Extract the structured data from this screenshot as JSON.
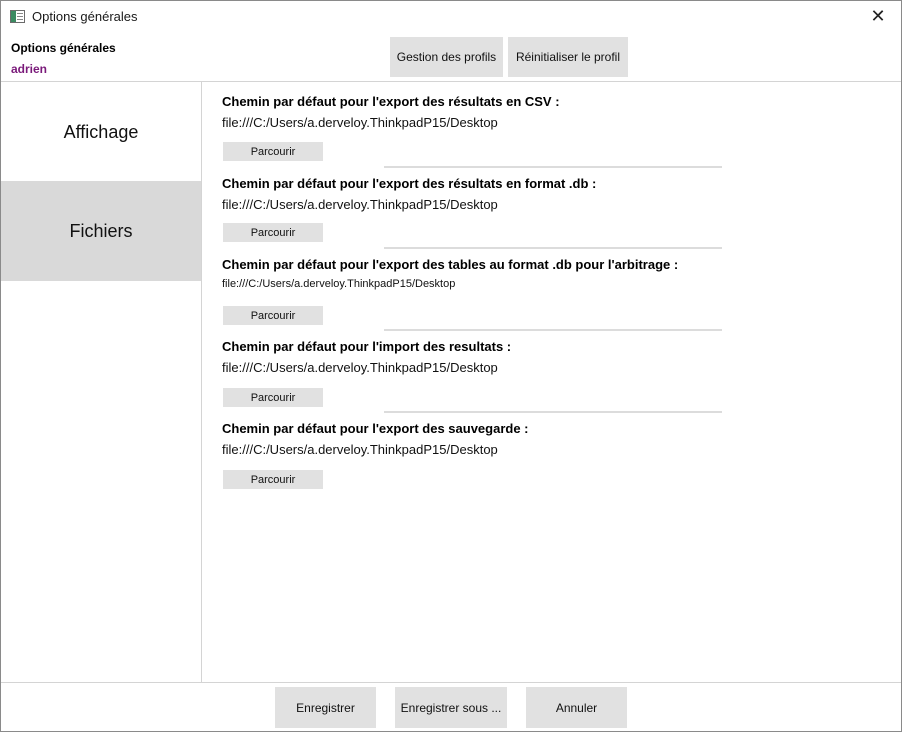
{
  "window": {
    "title": "Options générales",
    "close_icon": "close-icon",
    "app_icon": "app-window-icon"
  },
  "header": {
    "title": "Options générales",
    "user": "adrien",
    "user_color": "#7a1a7a",
    "profiles_button": "Gestion des profils",
    "reset_button": "Réinitialiser le profil"
  },
  "sidebar": {
    "items": [
      {
        "label": "Affichage",
        "selected": false
      },
      {
        "label": "Fichiers",
        "selected": true
      }
    ]
  },
  "sections": [
    {
      "title": "Chemin par défaut pour l'export des résultats en CSV :",
      "path": "file:///C:/Users/a.derveloy.ThinkpadP15/Desktop",
      "browse": "Parcourir"
    },
    {
      "title": "Chemin par défaut pour l'export des résultats en format .db :",
      "path": "file:///C:/Users/a.derveloy.ThinkpadP15/Desktop",
      "browse": "Parcourir"
    },
    {
      "title": "Chemin par défaut pour l'export des tables au format .db pour l'arbitrage :",
      "path": "file:///C:/Users/a.derveloy.ThinkpadP15/Desktop",
      "browse": "Parcourir"
    },
    {
      "title": "Chemin par défaut pour l'import des resultats :",
      "path": "file:///C:/Users/a.derveloy.ThinkpadP15/Desktop",
      "browse": "Parcourir"
    },
    {
      "title": "Chemin par défaut pour l'export des sauvegarde :",
      "path": "file:///C:/Users/a.derveloy.ThinkpadP15/Desktop",
      "browse": "Parcourir"
    }
  ],
  "footer": {
    "save": "Enregistrer",
    "save_as": "Enregistrer sous ...",
    "cancel": "Annuler"
  }
}
